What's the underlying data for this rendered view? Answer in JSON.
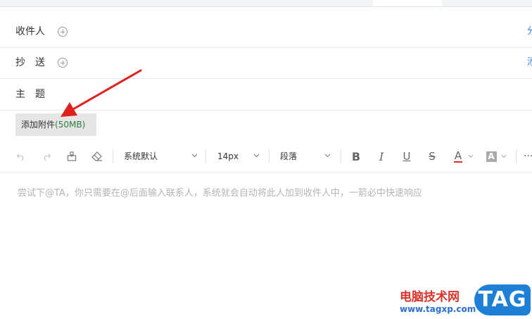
{
  "compose": {
    "to_label": "收件人",
    "cc_label": "抄　送",
    "subject_label": "主　题",
    "right_link_1": "分",
    "right_link_2": "添"
  },
  "attachment": {
    "label": "添加附件",
    "size": "(50MB)"
  },
  "toolbar": {
    "font_family": "系统默认",
    "font_size": "14px",
    "paragraph": "段落",
    "icons": [
      "undo-icon",
      "redo-icon",
      "format-painter-icon",
      "eraser-icon",
      "bold-icon",
      "italic-icon",
      "underline-icon",
      "strikethrough-icon",
      "font-color-icon",
      "background-color-icon",
      "more-icon"
    ],
    "font_color": "#d9342b"
  },
  "editor": {
    "placeholder": "尝试下@TA，你只需要在@后面输入联系人，系统就会自动将此人加到收件人中，一箭必中快速响应"
  },
  "watermark": {
    "site_name": "电脑技术网",
    "url": "www.tagxp.com",
    "logo": "TAG"
  },
  "colors": {
    "arrow": "#e0201b",
    "link": "#3a7ad9",
    "attach_size": "#2e7a3a"
  }
}
